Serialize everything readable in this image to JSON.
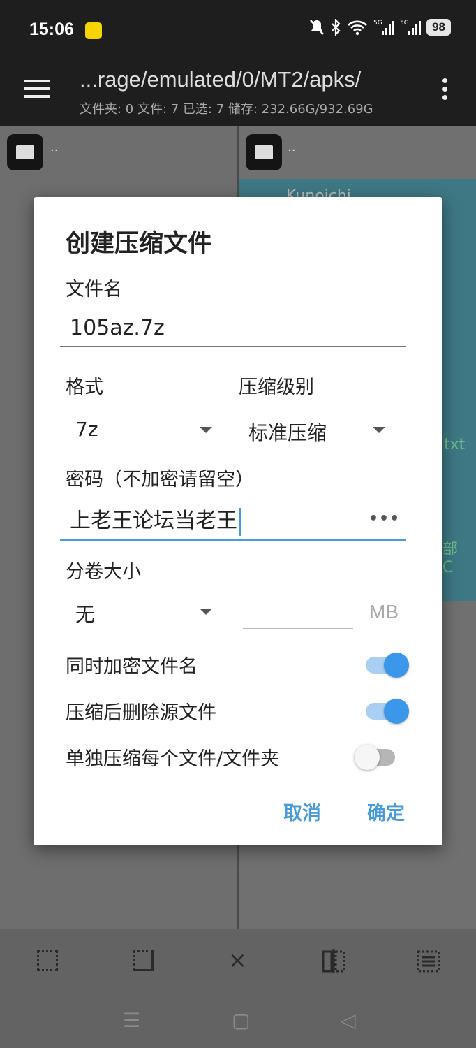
{
  "status_bar": {
    "time": "15:06",
    "icons": [
      "mute-icon",
      "bluetooth-icon",
      "wifi-icon",
      "signal-5g-icon",
      "signal-5g-icon"
    ],
    "battery": "98"
  },
  "toolbar": {
    "path": "...rage/emulated/0/MT2/apks/",
    "info": "文件夹: 0  文件: 7  已选: 7  储存: 232.66G/932.69G"
  },
  "left_pane": {
    "parent": ".."
  },
  "right_pane": {
    "parent": "..",
    "peek_name": "Kunoichi",
    "peek_txt": "txt",
    "peek_char1": "部",
    "peek_char2": "C"
  },
  "dialog": {
    "title": "创建压缩文件",
    "filename_label": "文件名",
    "filename_value": "105az.7z",
    "format_label": "格式",
    "format_value": "7z",
    "level_label": "压缩级别",
    "level_value": "标准压缩",
    "password_label": "密码（不加密请留空）",
    "password_value": "上老王论坛当老王",
    "password_toggle": "•••",
    "volume_label": "分卷大小",
    "volume_value": "无",
    "volume_unit": "MB",
    "encrypt_names_label": "同时加密文件名",
    "encrypt_names_on": true,
    "delete_source_label": "压缩后删除源文件",
    "delete_source_on": true,
    "separate_label": "单独压缩每个文件/文件夹",
    "separate_on": false,
    "cancel": "取消",
    "confirm": "确定"
  },
  "bottom_bar": {
    "icons": [
      "select-all-icon",
      "select-range-icon",
      "close-icon",
      "compare-icon",
      "list-select-icon"
    ],
    "close_glyph": "×"
  },
  "nav_bar": {
    "menu_glyph": "☰",
    "home_glyph": "▢",
    "back_glyph": "◁"
  },
  "colors": {
    "accent": "#3a97ea",
    "dark_bar": "#1e1e1e",
    "highlight": "#3e7884"
  }
}
